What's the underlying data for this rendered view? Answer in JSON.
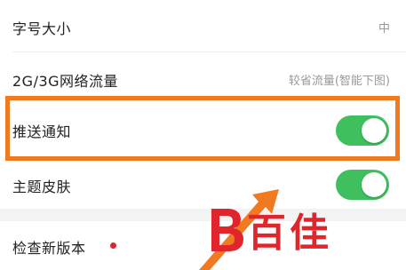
{
  "settings": {
    "font_size": {
      "label": "字号大小",
      "value": "中"
    },
    "network_traffic": {
      "label": "2G/3G网络流量",
      "value": "较省流量(智能下图)"
    },
    "push_notification": {
      "label": "推送通知",
      "toggle": "on"
    },
    "theme_skin": {
      "label": "主题皮肤",
      "toggle": "on"
    },
    "check_update": {
      "label": "检查新版本"
    }
  },
  "watermark": {
    "text": "百佳"
  },
  "colors": {
    "toggle_on": "#3fbf5e",
    "highlight": "#f07a1f",
    "badge_dot": "#e0252c"
  }
}
